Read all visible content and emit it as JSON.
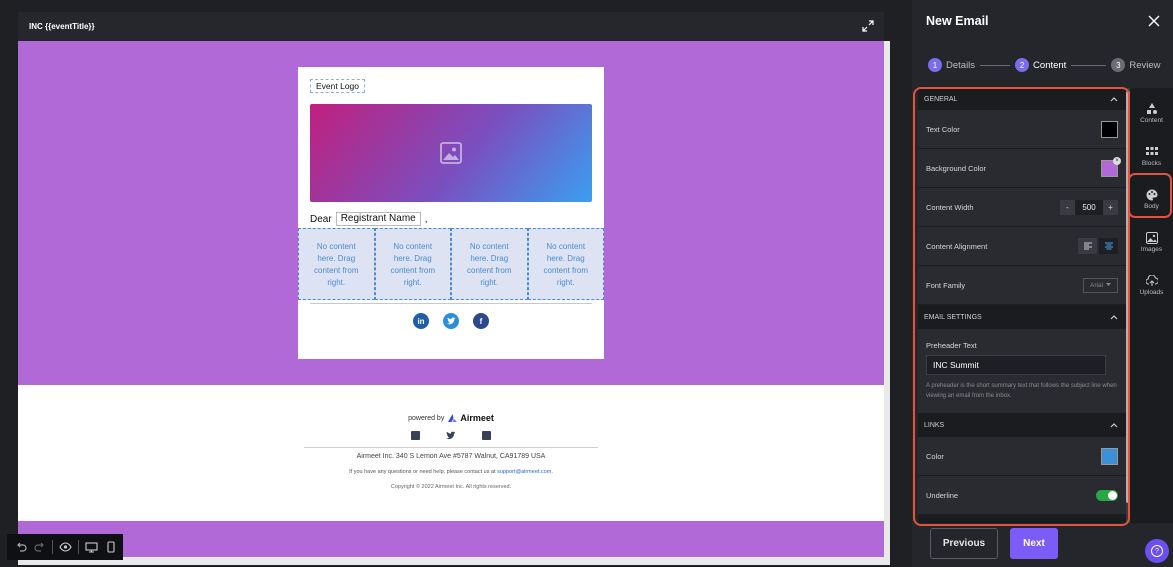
{
  "editor": {
    "title": "INC {{eventTitle}}"
  },
  "email": {
    "event_logo": "Event Logo",
    "dear": "Dear",
    "registrant_name": "Registrant Name",
    "comma": ",",
    "empty_column_text": "No content here. Drag content from right.",
    "columns": [
      "No content here. Drag content from right.",
      "No content here. Drag content from right.",
      "No content here. Drag content from right.",
      "No content here. Drag content from right."
    ],
    "socials": [
      "linkedin-icon",
      "twitter-icon",
      "facebook-icon"
    ]
  },
  "footer": {
    "powered_by": "powered by",
    "brand": "Airmeet",
    "address": "Airmeet Inc. 340 S Lemon Ave #5787 Walnut, CA91789 USA",
    "help_prefix": "If you have any questions or need help, please contact us at",
    "help_email": "support@airmeet.com",
    "help_suffix": ".",
    "copyright": "Copyright © 2022 Airmeet Inc. All rights reserved."
  },
  "panel": {
    "title": "New Email",
    "steps": [
      {
        "num": "1",
        "label": "Details"
      },
      {
        "num": "2",
        "label": "Content"
      },
      {
        "num": "3",
        "label": "Review"
      }
    ],
    "general": {
      "heading": "GENERAL",
      "text_color_label": "Text Color",
      "text_color": "#000000",
      "background_color_label": "Background Color",
      "background_color": "#b169d8",
      "content_width_label": "Content Width",
      "content_width_value": "500",
      "minus": "-",
      "plus": "+",
      "content_alignment_label": "Content Alignment",
      "font_family_label": "Font Family",
      "font_family_value": "Arial"
    },
    "email_settings": {
      "heading": "EMAIL SETTINGS",
      "preheader_label": "Preheader Text",
      "preheader_value": "INC Summit",
      "preheader_help": "A preheader is the short summary text that follows the subject line when viewing an email from the inbox."
    },
    "links": {
      "heading": "LINKS",
      "color_label": "Color",
      "color": "#3d8fd6",
      "underline_label": "Underline",
      "underline_on": true
    },
    "tabs": [
      {
        "label": "Content",
        "icon": "shapes-icon"
      },
      {
        "label": "Blocks",
        "icon": "grid-icon"
      },
      {
        "label": "Body",
        "icon": "palette-icon"
      },
      {
        "label": "Images",
        "icon": "image-icon"
      },
      {
        "label": "Uploads",
        "icon": "upload-icon"
      }
    ],
    "previous": "Previous",
    "next": "Next",
    "help": "?"
  },
  "colors": {
    "accent": "#7c5cf6",
    "highlight": "#e0533d",
    "canvas_background": "#b169d8"
  }
}
